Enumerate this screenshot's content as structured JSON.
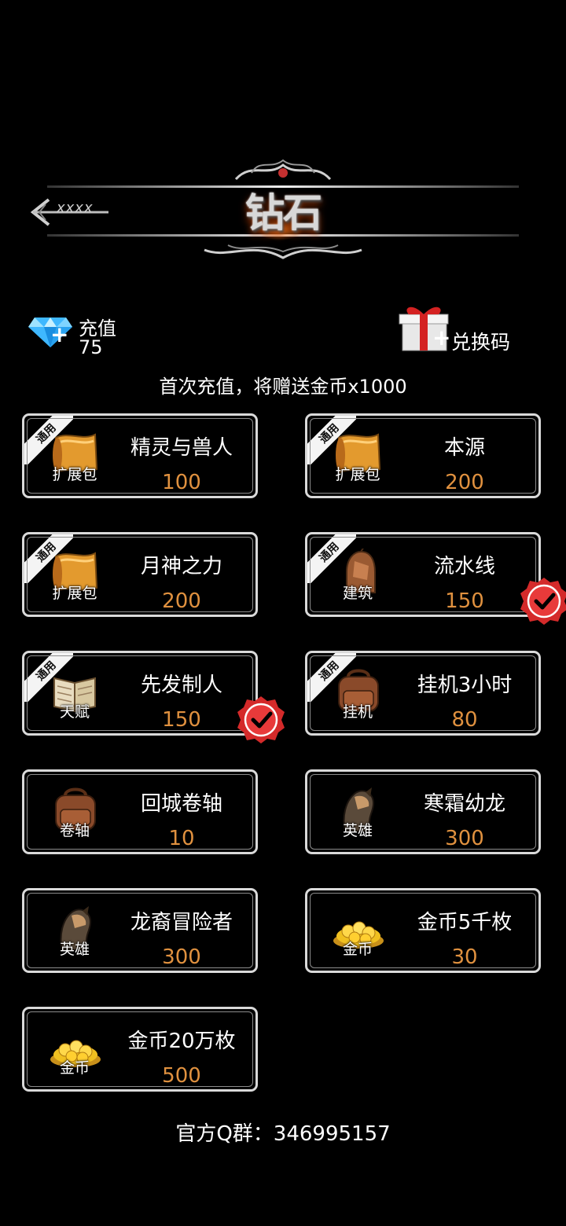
{
  "header": {
    "title": "钻石",
    "back_label": "xxxx"
  },
  "recharge": {
    "label": "充值",
    "diamonds": "75",
    "icon": "diamond-icon"
  },
  "redeem": {
    "label": "兑换码",
    "icon": "gift-icon"
  },
  "promo_text": "首次充值，将赠送金币x1000",
  "items": [
    {
      "name": "精灵与兽人",
      "price": "100",
      "caption": "扩展包",
      "tag": "通用",
      "icon": "scroll-icon",
      "checked": false
    },
    {
      "name": "本源",
      "price": "200",
      "caption": "扩展包",
      "tag": "通用",
      "icon": "scroll-icon",
      "checked": false
    },
    {
      "name": "月神之力",
      "price": "200",
      "caption": "扩展包",
      "tag": "通用",
      "icon": "scroll-icon",
      "checked": false
    },
    {
      "name": "流水线",
      "price": "150",
      "caption": "建筑",
      "tag": "通用",
      "icon": "building-icon",
      "checked": true
    },
    {
      "name": "先发制人",
      "price": "150",
      "caption": "天赋",
      "tag": "通用",
      "icon": "book-icon",
      "checked": true
    },
    {
      "name": "挂机3小时",
      "price": "80",
      "caption": "挂机",
      "tag": "通用",
      "icon": "backpack-icon",
      "checked": false
    },
    {
      "name": "回城卷轴",
      "price": "10",
      "caption": "卷轴",
      "tag": "",
      "icon": "backpack-icon",
      "checked": false
    },
    {
      "name": "寒霜幼龙",
      "price": "300",
      "caption": "英雄",
      "tag": "",
      "icon": "hero-icon",
      "checked": false
    },
    {
      "name": "龙裔冒险者",
      "price": "300",
      "caption": "英雄",
      "tag": "",
      "icon": "hero-icon",
      "checked": false
    },
    {
      "name": "金币5千枚",
      "price": "30",
      "caption": "金币",
      "tag": "",
      "icon": "gold-coins-icon",
      "checked": false
    },
    {
      "name": "金币20万枚",
      "price": "500",
      "caption": "金币",
      "tag": "",
      "icon": "gold-coins-icon",
      "checked": false
    }
  ],
  "qq_group": "官方Q群：346995157",
  "colors": {
    "price": "#e0913f",
    "card_border": "#d9d9d9",
    "badge": "#d42a2a",
    "background": "#000000"
  }
}
